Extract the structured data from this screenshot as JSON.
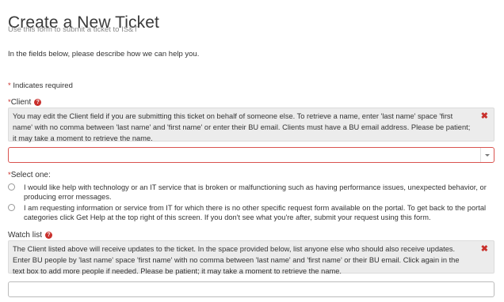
{
  "page": {
    "title": "Create a New Ticket",
    "subtitle": "Use this form to submit a ticket to IS&T",
    "intro": "In the fields below, please describe how we can help you.",
    "required_note": "Indicates required",
    "required_star": "*"
  },
  "client": {
    "label": "Client",
    "help_icon": "?",
    "info": "You may edit the Client field if you are submitting this ticket on behalf of someone else. To retrieve a name, enter 'last name' space 'first name' with no comma between 'last name' and 'first name' or enter their BU email. Clients must have a BU email address. Please be patient; it may take a moment to retrieve the name.",
    "close_icon": "✖",
    "value": ""
  },
  "select_one": {
    "label": "Select one:",
    "options": [
      "I would like help with technology or an IT service that is broken or malfunctioning such as having performance issues, unexpected behavior, or producing error messages.",
      "I am requesting information or service from IT for which there is no other specific request form available on the portal. To get back to the portal categories click Get Help at the top right of this screen. If you don't see what you're after, submit your request using this form."
    ]
  },
  "watch_list": {
    "label": "Watch list",
    "help_icon": "?",
    "info_line1": "The Client listed above will receive updates to the ticket. In the space provided below, list anyone else who should also receive updates.",
    "info_line2": "Enter BU people by 'last name' space 'first name' with no comma between 'last name' and 'first name' or their BU email. Click again in the text box to add more people if needed. Please be patient; it may take a moment to retrieve the name.",
    "close_icon": "✖",
    "value": ""
  },
  "colors": {
    "required": "#c9302c",
    "info_bg": "#ececec",
    "error_border": "#d9534f"
  }
}
